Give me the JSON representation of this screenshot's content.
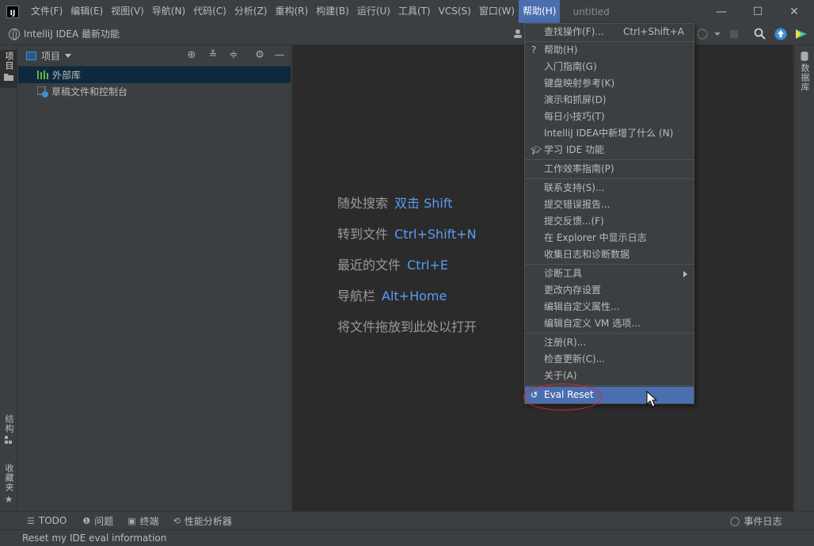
{
  "titlebar": {
    "menus": [
      "文件(F)",
      "编辑(E)",
      "视图(V)",
      "导航(N)",
      "代码(C)",
      "分析(Z)",
      "重构(R)",
      "构建(B)",
      "运行(U)",
      "工具(T)",
      "VCS(S)",
      "窗口(W)",
      "帮助(H)"
    ],
    "active_menu": "帮助(H)",
    "window_title": "untitled",
    "minimize": "—",
    "maximize": "☐",
    "close": "✕"
  },
  "navbar": {
    "title": "IntelliJ IDEA 最新功能"
  },
  "left_strip": {
    "project": "项目",
    "structure": "结构",
    "favorites": "收藏夹"
  },
  "right_strip": {
    "database": "数据库"
  },
  "project_panel": {
    "title": "项目",
    "tree": [
      {
        "label": "外部库",
        "selected": true
      },
      {
        "label": "草稿文件和控制台",
        "selected": false
      }
    ]
  },
  "editor": {
    "hints": [
      {
        "text": "随处搜索",
        "key": "双击 Shift"
      },
      {
        "text": "转到文件",
        "key": "Ctrl+Shift+N"
      },
      {
        "text": "最近的文件",
        "key": "Ctrl+E"
      },
      {
        "text": "导航栏",
        "key": "Alt+Home"
      },
      {
        "text": "将文件拖放到此处以打开",
        "key": ""
      }
    ]
  },
  "help_menu": {
    "items": [
      {
        "label": "查找操作(F)...",
        "shortcut": "Ctrl+Shift+A"
      },
      {
        "label": "帮助(H)",
        "icon": "?"
      },
      {
        "label": "入门指南(G)"
      },
      {
        "label": "键盘映射参考(K)"
      },
      {
        "label": "演示和抓屏(D)"
      },
      {
        "label": "每日小技巧(T)"
      },
      {
        "label": "IntelliJ IDEA中新增了什么 (N)"
      },
      {
        "label": "学习 IDE 功能"
      },
      {
        "label": "工作效率指南(P)"
      },
      {
        "label": "联系支持(S)..."
      },
      {
        "label": "提交错误报告..."
      },
      {
        "label": "提交反馈...(F)"
      },
      {
        "label": "在 Explorer 中显示日志"
      },
      {
        "label": "收集日志和诊断数据"
      },
      {
        "label": "诊断工具"
      },
      {
        "label": "更改内存设置"
      },
      {
        "label": "编辑自定义属性..."
      },
      {
        "label": "编辑自定义 VM 选项..."
      },
      {
        "label": "注册(R)..."
      },
      {
        "label": "检查更新(C)..."
      },
      {
        "label": "关于(A)"
      },
      {
        "label": "Eval Reset",
        "highlighted": true
      }
    ]
  },
  "bottombar": {
    "tabs": [
      "TODO",
      "问题",
      "终端",
      "性能分析器"
    ],
    "event_log": "事件日志"
  },
  "statusbar": {
    "text": "Reset my IDE eval information"
  }
}
